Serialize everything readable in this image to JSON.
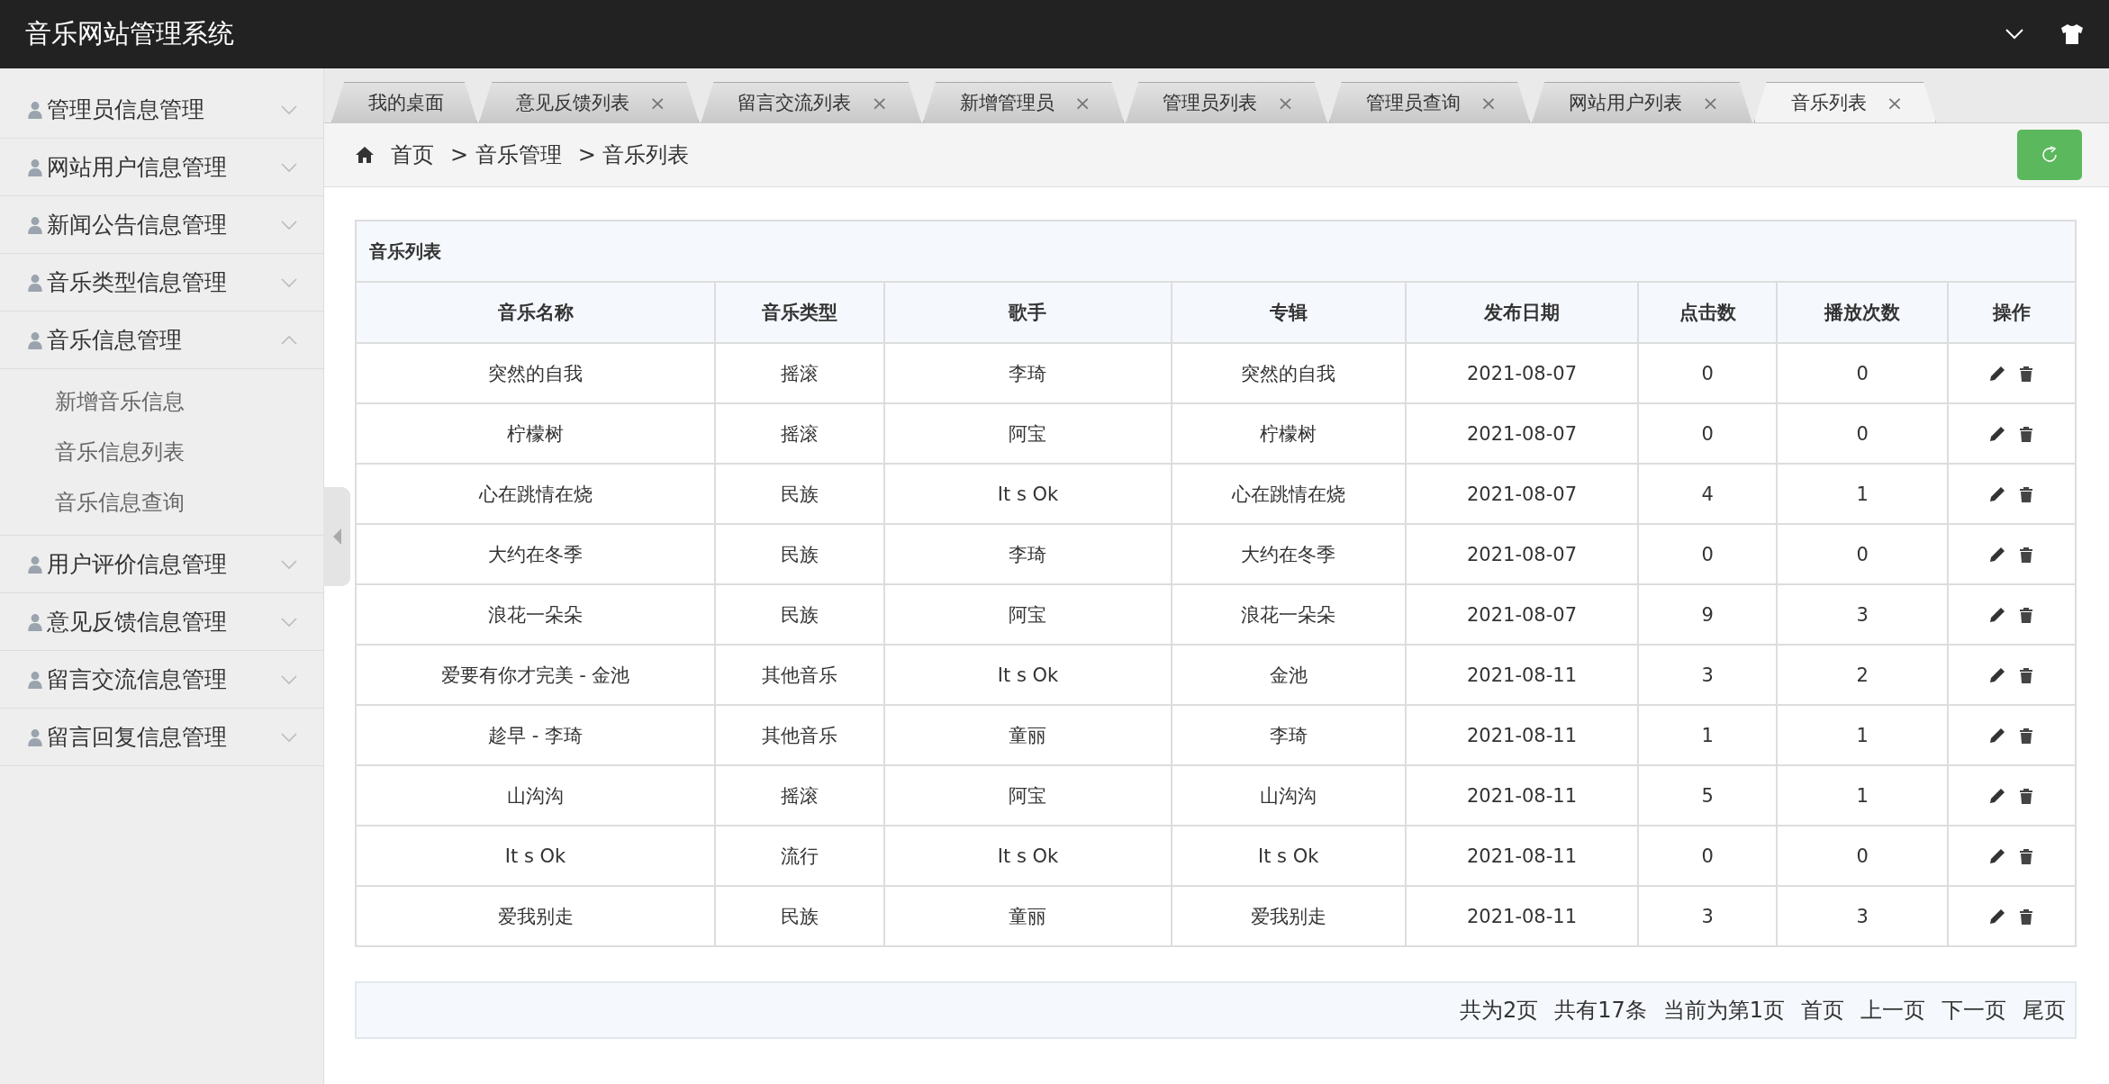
{
  "header": {
    "title": "音乐网站管理系统"
  },
  "sidebar": {
    "items": [
      {
        "label": "管理员信息管理",
        "expanded": false
      },
      {
        "label": "网站用户信息管理",
        "expanded": false
      },
      {
        "label": "新闻公告信息管理",
        "expanded": false
      },
      {
        "label": "音乐类型信息管理",
        "expanded": false
      },
      {
        "label": "音乐信息管理",
        "expanded": true,
        "children": [
          {
            "label": "新增音乐信息"
          },
          {
            "label": "音乐信息列表"
          },
          {
            "label": "音乐信息查询"
          }
        ]
      },
      {
        "label": "用户评价信息管理",
        "expanded": false
      },
      {
        "label": "意见反馈信息管理",
        "expanded": false
      },
      {
        "label": "留言交流信息管理",
        "expanded": false
      },
      {
        "label": "留言回复信息管理",
        "expanded": false
      }
    ]
  },
  "tabs": [
    {
      "label": "我的桌面",
      "selected": false
    },
    {
      "label": "意见反馈列表",
      "close": "×",
      "selected": false
    },
    {
      "label": "留言交流列表",
      "close": "×",
      "selected": false
    },
    {
      "label": "新增管理员",
      "close": "×",
      "selected": false
    },
    {
      "label": "管理员列表",
      "close": "×",
      "selected": false
    },
    {
      "label": "管理员查询",
      "close": "×",
      "selected": false
    },
    {
      "label": "网站用户列表",
      "close": "×",
      "selected": false
    },
    {
      "label": "音乐列表",
      "close": "×",
      "selected": true
    }
  ],
  "breadcrumb": [
    "首页",
    "> 音乐管理",
    "> 音乐列表"
  ],
  "table": {
    "title": "音乐列表",
    "columns": [
      "音乐名称",
      "音乐类型",
      "歌手",
      "专辑",
      "发布日期",
      "点击数",
      "播放次数",
      "操作"
    ],
    "rows": [
      [
        "突然的自我",
        "摇滚",
        "李琦",
        "突然的自我",
        "2021-08-07",
        "0",
        "0"
      ],
      [
        "柠檬树",
        "摇滚",
        "阿宝",
        "柠檬树",
        "2021-08-07",
        "0",
        "0"
      ],
      [
        "心在跳情在烧",
        "民族",
        "It s Ok",
        "心在跳情在烧",
        "2021-08-07",
        "4",
        "1"
      ],
      [
        "大约在冬季",
        "民族",
        "李琦",
        "大约在冬季",
        "2021-08-07",
        "0",
        "0"
      ],
      [
        "浪花一朵朵",
        "民族",
        "阿宝",
        "浪花一朵朵",
        "2021-08-07",
        "9",
        "3"
      ],
      [
        "爱要有你才完美 - 金池",
        "其他音乐",
        "It s Ok",
        "金池",
        "2021-08-11",
        "3",
        "2"
      ],
      [
        "趁早 - 李琦",
        "其他音乐",
        "童丽",
        "李琦",
        "2021-08-11",
        "1",
        "1"
      ],
      [
        "山沟沟",
        "摇滚",
        "阿宝",
        "山沟沟",
        "2021-08-11",
        "5",
        "1"
      ],
      [
        "It s Ok",
        "流行",
        "It s Ok",
        "It s Ok",
        "2021-08-11",
        "0",
        "0"
      ],
      [
        "爱我别走",
        "民族",
        "童丽",
        "爱我别走",
        "2021-08-11",
        "3",
        "3"
      ]
    ]
  },
  "pagination": [
    "共为2页",
    "共有17条",
    "当前为第1页",
    "首页",
    "上一页",
    "下一页",
    "尾页"
  ]
}
